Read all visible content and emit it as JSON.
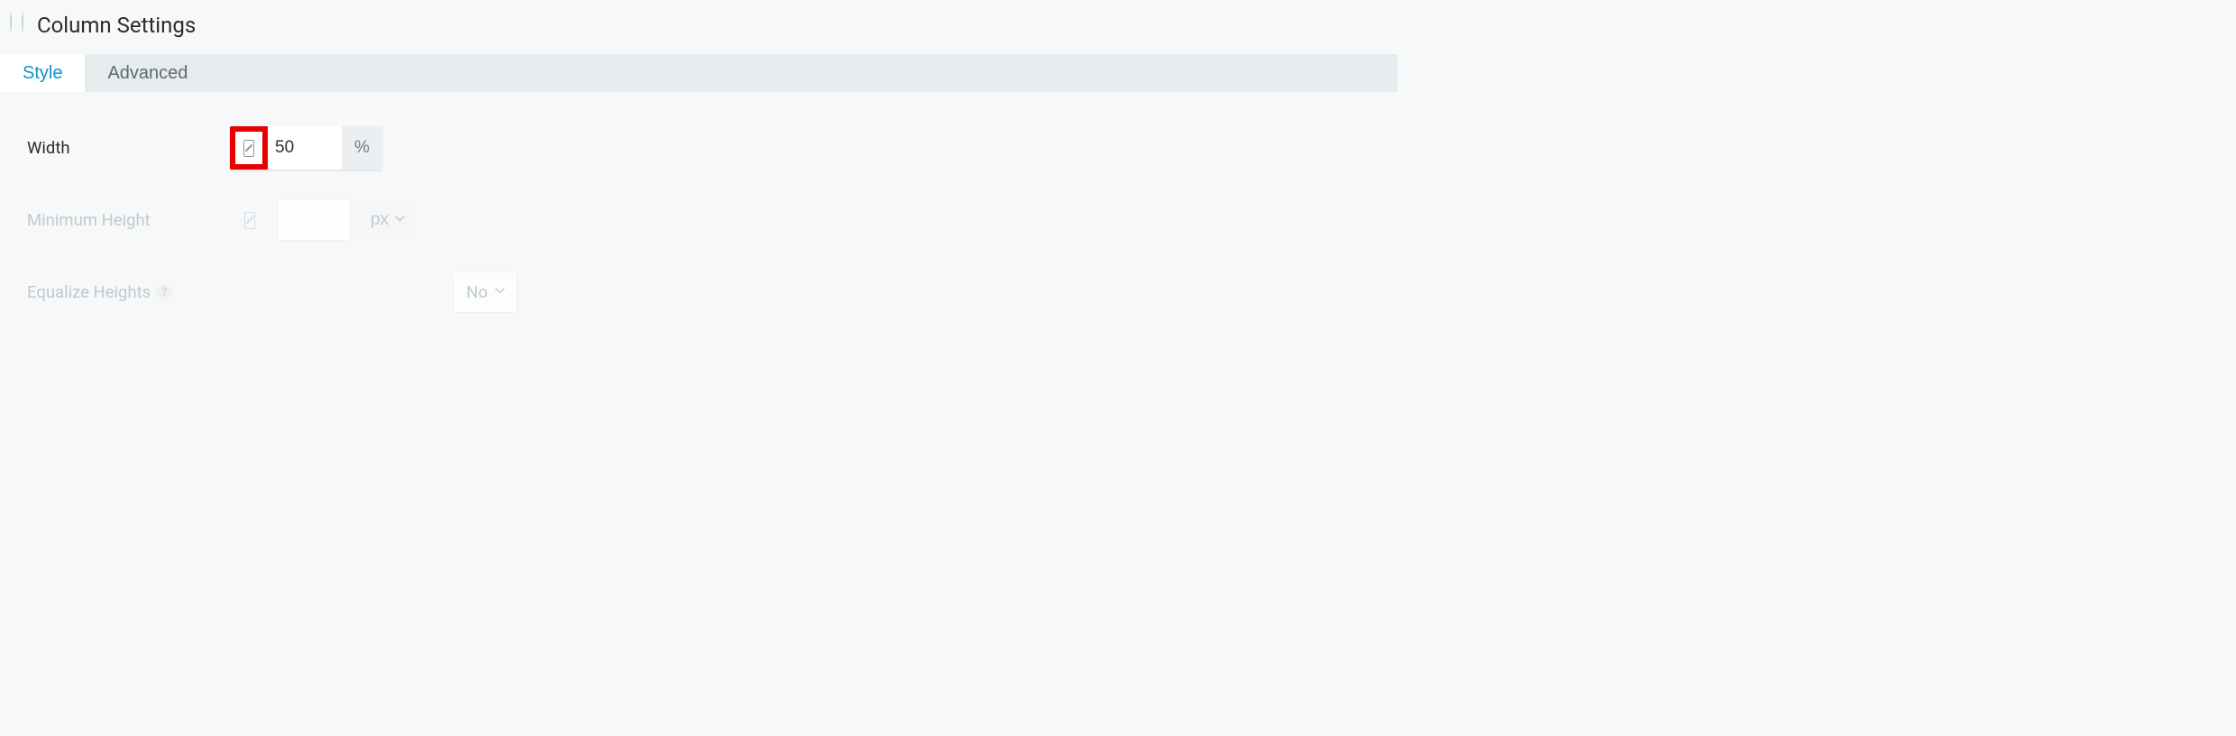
{
  "header": {
    "title": "Column Settings"
  },
  "tabs": {
    "style": "Style",
    "advanced": "Advanced"
  },
  "fields": {
    "width": {
      "label": "Width",
      "value": "50",
      "unit": "%"
    },
    "min_height": {
      "label": "Minimum Height",
      "value": "",
      "unit": "px"
    },
    "equalize": {
      "label": "Equalize Heights",
      "value": "No"
    }
  }
}
